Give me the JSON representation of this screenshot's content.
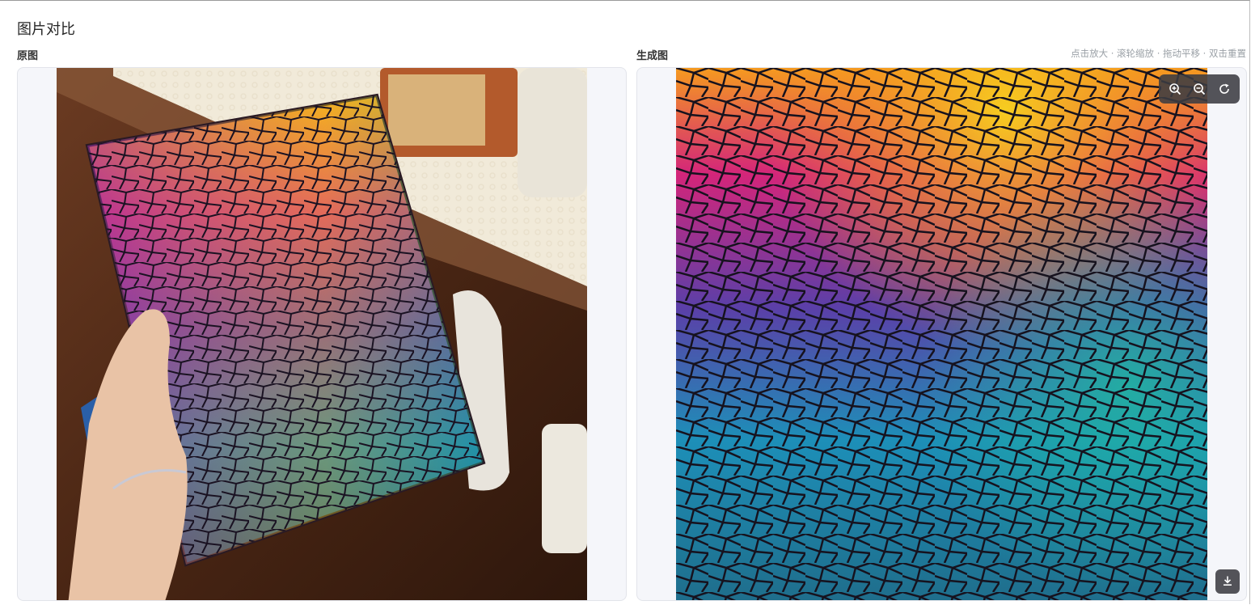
{
  "page": {
    "title": "图片对比"
  },
  "original": {
    "label": "原图",
    "image_icon": "photo-hand-holding-mosaic-tablet-case"
  },
  "generated": {
    "label": "生成图",
    "hint": "点击放大 · 滚轮缩放 · 拖动平移 · 双击重置",
    "image_icon": "stained-glass-mosaic-pattern",
    "toolbar": {
      "zoom_in_icon": "zoom-in-icon",
      "zoom_out_icon": "zoom-out-icon",
      "reset_icon": "reset-icon"
    },
    "download_icon": "download-icon"
  },
  "colors": {
    "panel_bg": "#f5f6fa",
    "toolbar_bg": "#3c3c42",
    "hint_text": "#9aa0a6",
    "mosaic_palette": [
      "#f7d21e",
      "#f59a1f",
      "#e2562c",
      "#d4257a",
      "#9b2fb0",
      "#5b3fa8",
      "#2a5fa8",
      "#1d8fb8",
      "#20b7a0",
      "#1f6e8c"
    ]
  }
}
